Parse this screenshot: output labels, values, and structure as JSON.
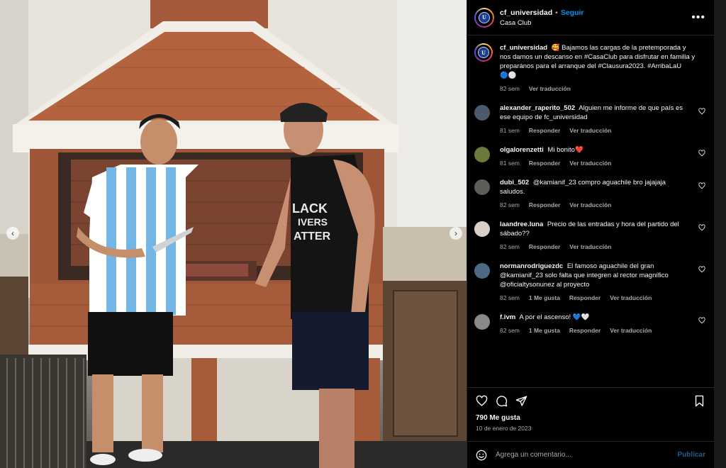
{
  "post": {
    "username": "cf_universidad",
    "separator": "•",
    "follow_label": "Seguir",
    "location": "Casa Club",
    "more_label": "•••",
    "avatar_text": "U"
  },
  "caption": {
    "username": "cf_universidad",
    "text": "🥰 Bajamos las cargas de la pretemporada y nos damos un descanso en #CasaClub para disfrutar en familia y preparános para el arranque del #Clausura2023. #ArribaLaU 🔵⚪",
    "time": "82 sem",
    "translate": "Ver traducción"
  },
  "comments": [
    {
      "username": "alexander_raperito_502",
      "text": "Alguien me informe de que país es ese equipo de fc_universidad",
      "time": "81 sem",
      "reply": "Responder",
      "translate": "Ver traducción",
      "avatar_color": "#4a5a6a"
    },
    {
      "username": "olgalorenzetti",
      "text": "Mi bonito❤️",
      "time": "81 sem",
      "reply": "Responder",
      "translate": "Ver traducción",
      "avatar_color": "#6b7a3a"
    },
    {
      "username": "dubi_502",
      "text": "@kamianif_23 compro aguachile bro jajajaja saludos.",
      "time": "82 sem",
      "reply": "Responder",
      "translate": "Ver traducción",
      "avatar_color": "#5c5f58"
    },
    {
      "username": "laandree.luna",
      "text": "Precio de las entradas y hora del partido del sábado??",
      "time": "82 sem",
      "reply": "Responder",
      "translate": "Ver traducción",
      "avatar_color": "#d9cfc8"
    },
    {
      "username": "normanrodriguezdc",
      "text": "El famoso aguachile del gran @kamianif_23 solo falta que integren al rector magnífico @oficialtysonunez al proyecto",
      "time": "82 sem",
      "likes": "1 Me gusta",
      "reply": "Responder",
      "translate": "Ver traducción",
      "avatar_color": "#4d6a85"
    },
    {
      "username": "f.ivm",
      "text": "A por el ascenso! 💙🤍",
      "time": "82 sem",
      "likes": "1 Me gusta",
      "reply": "Responder",
      "translate": "Ver traducción",
      "avatar_color": "#8a8a8a"
    }
  ],
  "actions": {
    "likes_text": "790 Me gusta",
    "date_text": "10 de enero de 2023"
  },
  "compose": {
    "placeholder": "Agrega un comentario...",
    "publish_label": "Publicar"
  },
  "nav": {
    "prev": "‹",
    "next": "›"
  },
  "colors": {
    "accent": "#0095f6",
    "background": "#000000",
    "muted": "#a8a8a8"
  }
}
